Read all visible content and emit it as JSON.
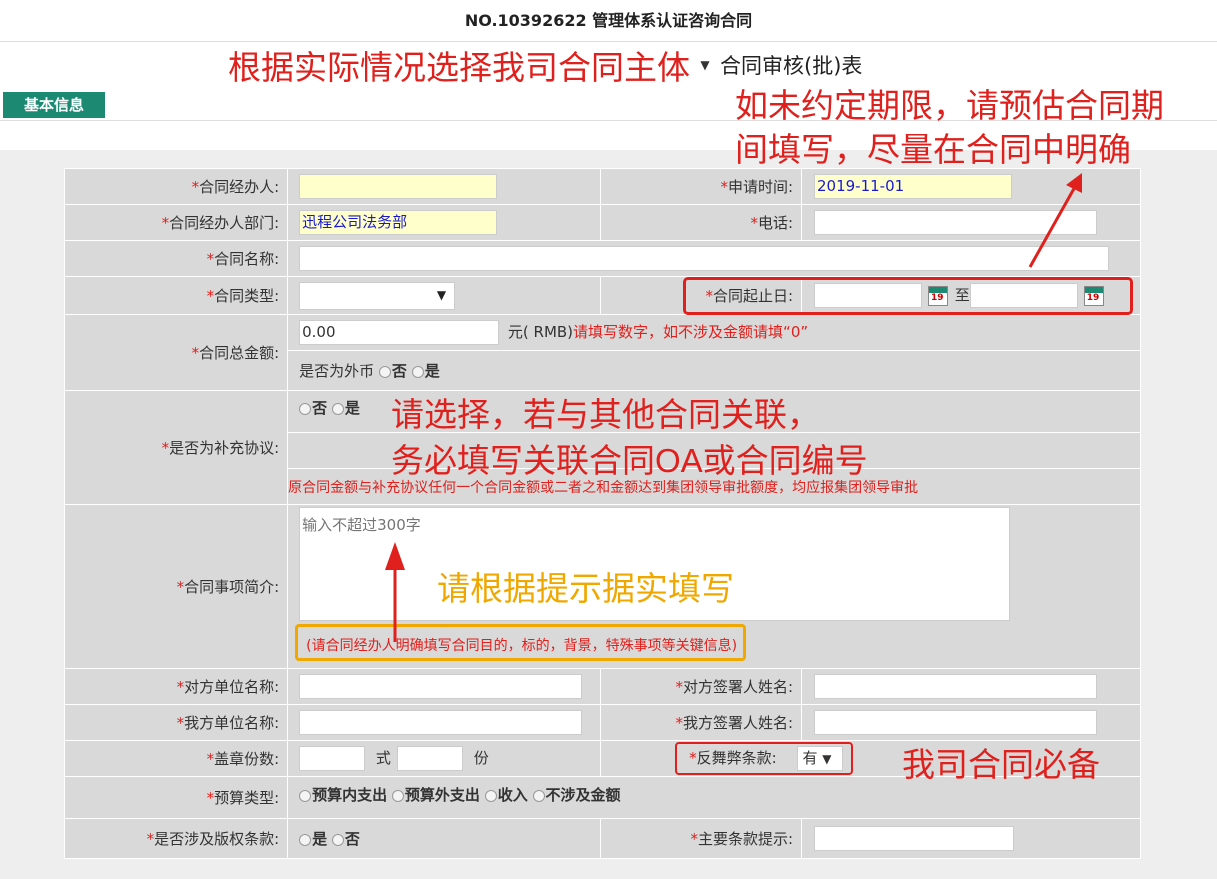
{
  "header": {
    "title": "NO.10392622 管理体系认证咨询合同"
  },
  "subtitle": {
    "entity_hint": "根据实际情况选择我司合同主体",
    "select_arrow": "▼",
    "form_title": "合同审核(批)表"
  },
  "tabs": {
    "basic_info": "基本信息"
  },
  "annotations": {
    "period_hint_line1": "如未约定期限，请预估合同期",
    "period_hint_line2": "间填写，尽量在合同中明确",
    "supplement_hint_line1": "请选择，若与其他合同关联，",
    "supplement_hint_line2": "务必填写关联合同OA或合同编号",
    "summary_hint": "请根据提示据实填写",
    "anti_fraud_hint": "我司合同必备"
  },
  "form": {
    "handler_label": "合同经办人:",
    "apply_time_label": "申请时间:",
    "apply_time_value": "2019-11-01",
    "dept_label": "合同经办人部门:",
    "dept_value": "迅程公司法务部",
    "phone_label": "电话:",
    "name_label": "合同名称:",
    "type_label": "合同类型:",
    "type_arrow": "▼",
    "period_label": "合同起止日:",
    "period_to": "至",
    "calendar_day": "19",
    "amount_label": "合同总金额:",
    "amount_value": "0.00",
    "amount_unit": "元( RMB)",
    "amount_note": "请填写数字，如不涉及金额请填“0”",
    "foreign_label": "是否为外币",
    "no": "否",
    "yes": "是",
    "supplement_label": "是否为补充协议:",
    "supplement_note": "原合同金额与补充协议任何一个合同金额或二者之和金额达到集团领导审批额度，均应报集团领导审批",
    "summary_label": "合同事项简介:",
    "summary_placeholder": "输入不超过300字",
    "summary_note": "(请合同经办人明确填写合同目的，标的，背景，特殊事项等关键信息)",
    "counterparty_label": "对方单位名称:",
    "counterparty_signer_label": "对方签署人姓名:",
    "our_party_label": "我方单位名称:",
    "our_signer_label": "我方签署人姓名:",
    "seal_copies_label": "盖章份数:",
    "seal_unit1": "式",
    "seal_unit2": "份",
    "anti_fraud_label": "反舞弊条款:",
    "anti_fraud_value": "有",
    "anti_fraud_arrow": "▼",
    "budget_label": "预算类型:",
    "budget_options": [
      "预算内支出",
      "预算外支出",
      "收入",
      "不涉及金额"
    ],
    "copyright_label": "是否涉及版权条款:",
    "key_terms_label": "主要条款提示:",
    "required_mark": "*"
  },
  "colors": {
    "accent": "#1c8a73",
    "annotation_red": "#e0201c",
    "annotation_orange": "#f0a800"
  }
}
